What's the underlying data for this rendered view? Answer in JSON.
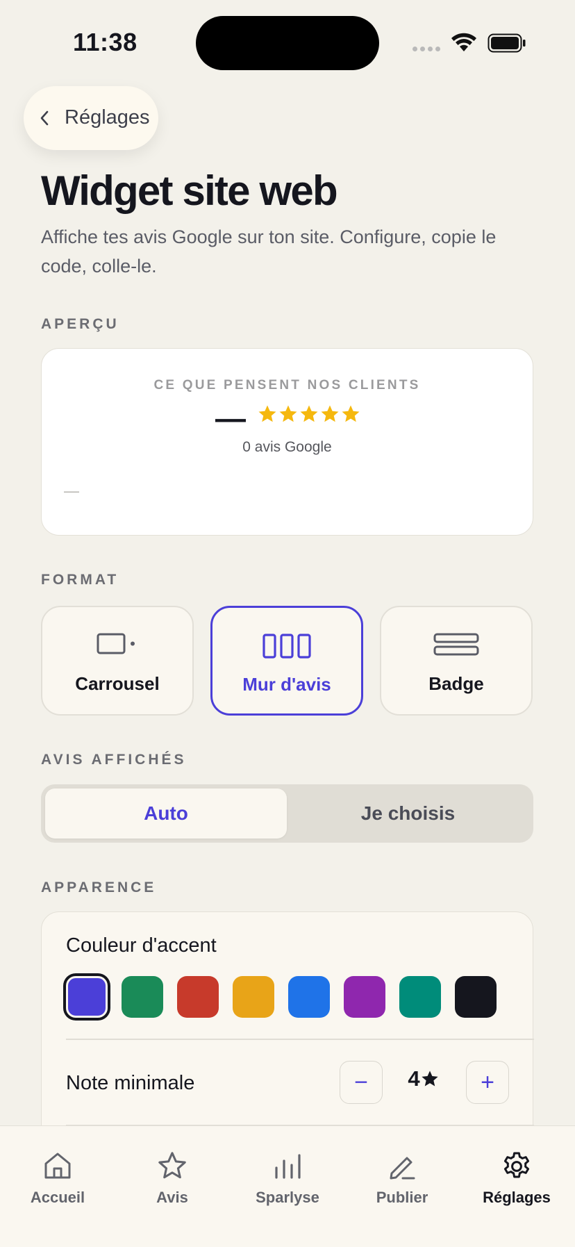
{
  "status_bar": {
    "time": "11:38"
  },
  "header": {
    "back_label": "Réglages"
  },
  "page": {
    "title": "Widget site web",
    "subtitle": "Affiche tes avis Google sur ton site. Configure, copie le code, colle-le."
  },
  "preview": {
    "section_label": "APERÇU",
    "heading": "CE QUE PENSENT NOS CLIENTS",
    "rating_value": "—",
    "stars_shown": 5,
    "review_count": "0 avis Google",
    "placeholder": "—"
  },
  "format": {
    "section_label": "FORMAT",
    "options": [
      {
        "label": "Carrousel",
        "icon": "carousel-icon",
        "selected": false
      },
      {
        "label": "Mur d'avis",
        "icon": "wall-icon",
        "selected": true
      },
      {
        "label": "Badge",
        "icon": "badge-icon",
        "selected": false
      }
    ]
  },
  "reviews_shown": {
    "section_label": "AVIS AFFICHÉS",
    "options": [
      "Auto",
      "Je choisis"
    ],
    "selected": "Auto"
  },
  "appearance": {
    "section_label": "APPARENCE",
    "accent_label": "Couleur d'accent",
    "accent_colors": [
      "#4B3FD8",
      "#1A8B58",
      "#C73A2B",
      "#E8A418",
      "#1F73E8",
      "#8F27AE",
      "#008C7A",
      "#15161E"
    ],
    "selected_color": "#4B3FD8",
    "min_rating_label": "Note minimale",
    "min_rating_value": "4",
    "decrement_label": "−",
    "increment_label": "+"
  },
  "tab_bar": {
    "items": [
      {
        "label": "Accueil",
        "icon": "home-icon",
        "active": false
      },
      {
        "label": "Avis",
        "icon": "star-icon",
        "active": false
      },
      {
        "label": "Sparlyse",
        "icon": "bar-chart-icon",
        "active": false
      },
      {
        "label": "Publier",
        "icon": "pen-icon",
        "active": false
      },
      {
        "label": "Réglages",
        "icon": "gear-icon",
        "active": true
      }
    ]
  },
  "colors": {
    "accent": "#4B3FD8",
    "background": "#F3F1EA",
    "star": "#F5B80F"
  }
}
